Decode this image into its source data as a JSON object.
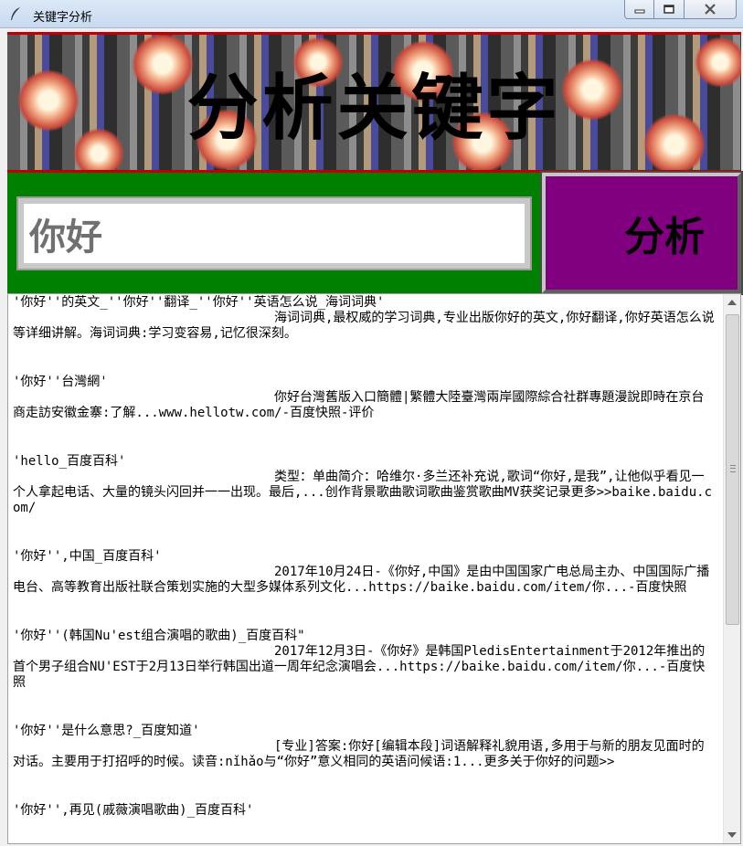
{
  "window": {
    "title": "关键字分析",
    "icon": "feather-icon",
    "controls": [
      "minimize-icon",
      "maximize-icon",
      "close-icon"
    ]
  },
  "banner": {
    "title": "分析关键字"
  },
  "search": {
    "value": "你好"
  },
  "analyze_button": {
    "label": "分析"
  },
  "colors": {
    "banner_border": "#c00000",
    "input_panel": "#008000",
    "button": "#800080"
  },
  "results": [
    {
      "title": "'你好''的英文_''你好''翻译_''你好''英语怎么说_海词词典'",
      "desc": "海词词典,最权威的学习词典,专业出版你好的英文,你好翻译,你好英语怎么说等详细讲解。海词词典:学习变容易,记忆很深刻。"
    },
    {
      "title": "'你好''台灣網'",
      "desc": "你好台灣舊版入口簡體|繁體大陸臺灣兩岸國際綜合社群專題漫說即時在京台商走訪安徽金寨:了解...www.hellotw.com/-百度快照-评价"
    },
    {
      "title": "'hello_百度百科'",
      "desc": "类型：单曲简介：哈维尔·多兰还补充说,歌词“你好,是我”,让他似乎看见一个人拿起电话、大量的镜头闪回并一一出现。最后,...创作背景歌曲歌词歌曲鉴赏歌曲MV获奖记录更多>>baike.baidu.com/"
    },
    {
      "title": "'你好'',中国_百度百科'",
      "desc": "2017年10月24日-《你好,中国》是由中国国家广电总局主办、中国国际广播电台、高等教育出版社联合策划实施的大型多媒体系列文化...https://baike.baidu.com/item/你...-百度快照"
    },
    {
      "title": "'你好''(韩国Nu'est组合演唱的歌曲)_百度百科\"",
      "desc": "2017年12月3日-《你好》是韩国PledisEntertainment于2012年推出的首个男子组合NU'EST于2月13日举行韩国出道一周年纪念演唱会...https://baike.baidu.com/item/你...-百度快照"
    },
    {
      "title": "'你好''是什么意思?_百度知道'",
      "desc": "[专业]答案:你好[编辑本段]词语解释礼貌用语,多用于与新的朋友见面时的对话。主要用于打招呼的时候。读音:nǐhǎo与“你好”意义相同的英语问候语:1...更多关于你好的问题>>"
    },
    {
      "title": "'你好'',再见(戚薇演唱歌曲)_百度百科'",
      "desc": ""
    }
  ]
}
